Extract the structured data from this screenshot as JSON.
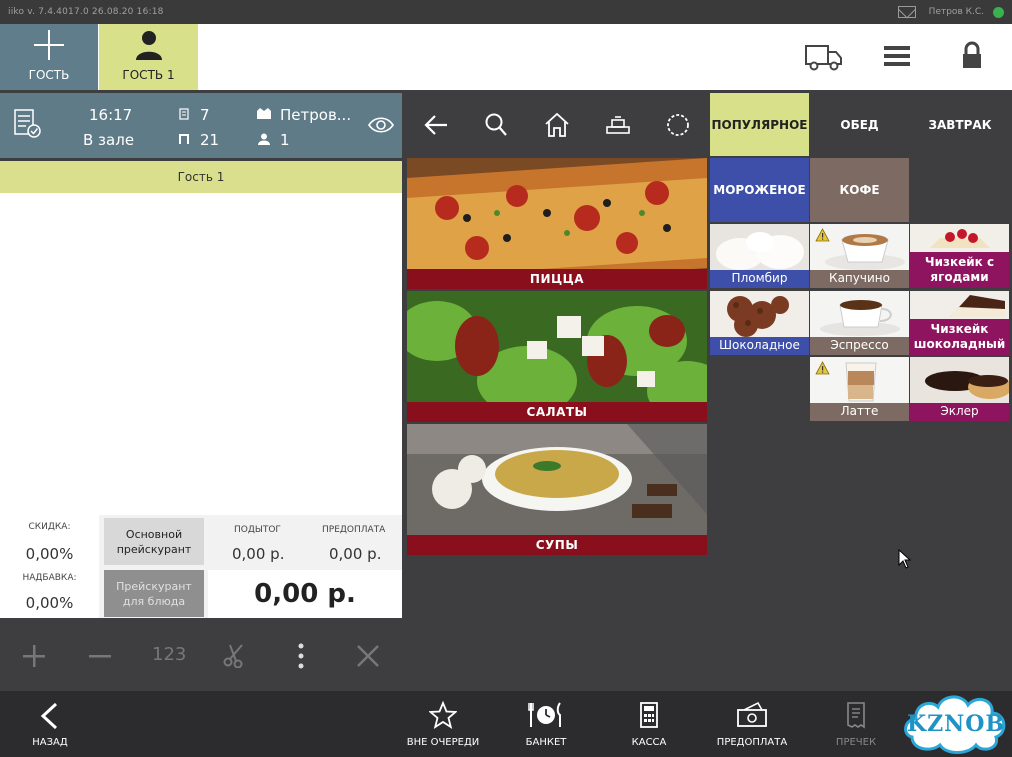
{
  "titlebar": {
    "left": "iiko  v. 7.4.4017.0     26.08.20   16:18",
    "user": "Петров К.С."
  },
  "header": {
    "add_guest_label": "ГОСТЬ",
    "guest_tab_label": "ГОСТЬ 1"
  },
  "order": {
    "time": "16:17",
    "location": "В зале",
    "guests_count": "7",
    "table_no": "21",
    "waiter": "Петров...",
    "persons": "1"
  },
  "guest_row": "Гость 1",
  "totals": {
    "discount_label": "СКИДКА:",
    "discount_value": "0,00%",
    "markup_label": "НАДБАВКА:",
    "markup_value": "0,00%",
    "pricelist_main": "Основной прейскурант",
    "pricelist_dish": "Прейскурант для блюда",
    "subtotal_label": "ПОДЫТОГ",
    "subtotal_value": "0,00 р.",
    "prepay_label": "ПРЕДОПЛАТА",
    "prepay_value": "0,00 р.",
    "total": "0,00 р."
  },
  "actions": {
    "qty": "123"
  },
  "categories": {
    "popular": "ПОПУЛЯРНОЕ",
    "lunch": "ОБЕД",
    "breakfast": "ЗАВТРАК",
    "icecream": "МОРОЖЕНОЕ",
    "coffee": "КОФЕ"
  },
  "groups": {
    "pizza": "ПИЦЦА",
    "salads": "САЛАТЫ",
    "soups": "СУПЫ"
  },
  "items": {
    "plombir": "Пломбир",
    "cappuccino": "Капучино",
    "cheesecake_berries": "Чизкейк с ягодами",
    "chocolate": "Шоколадное",
    "espresso": "Эспрессо",
    "cheesecake_choc": "Чизкейк шоколадный",
    "latte": "Латте",
    "eclair": "Эклер"
  },
  "bottom": {
    "back": "НАЗАД",
    "queue": "ВНЕ ОЧЕРЕДИ",
    "banquet": "БАНКЕТ",
    "cash": "КАССА",
    "prepay": "ПРЕДОПЛАТА",
    "precheck": "ПРЕЧЕК"
  },
  "watermark": "KZNOB",
  "colors": {
    "accent_yellow": "#d8e18a",
    "slate": "#607b88",
    "group_red": "#8a0f1c",
    "icecream_blue": "#3d4fa8",
    "coffee_brown": "#7d6b63",
    "dessert_purple": "#8f1460"
  }
}
